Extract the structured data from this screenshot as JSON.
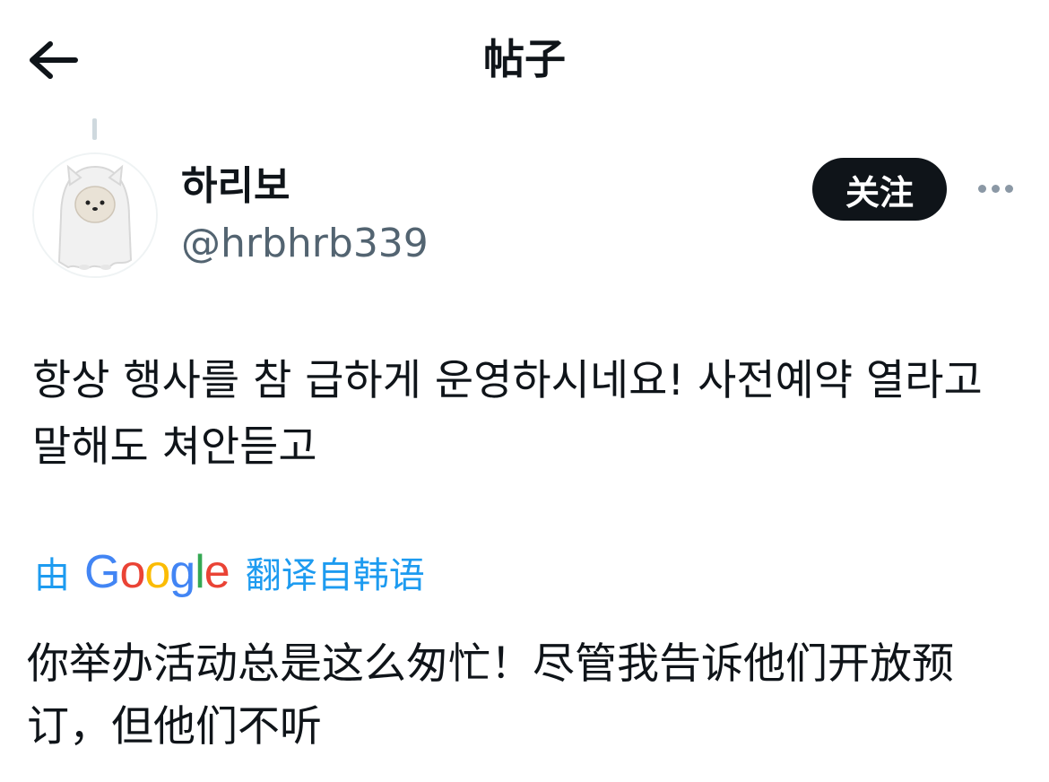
{
  "header": {
    "title": "帖子",
    "back_icon": "arrow-left-icon"
  },
  "author": {
    "display_name": "하리보",
    "handle": "@hrbhrb339",
    "avatar_icon": "ghost-dog-avatar"
  },
  "actions": {
    "follow_label": "关注",
    "more_icon": "more-horizontal-icon"
  },
  "post": {
    "text": "항상 행사를 참 급하게 운영하시네요! 사전예약 열라고 말해도 쳐안듣고"
  },
  "translation": {
    "by_label": "由",
    "provider_letters": [
      "G",
      "o",
      "o",
      "g",
      "l",
      "e"
    ],
    "from_label": "翻译自韩语",
    "text": "你举办活动总是这么匆忙！尽管我告诉他们开放预订，但他们不听"
  },
  "colors": {
    "text_primary": "#0f1419",
    "text_secondary": "#536471",
    "link_blue": "#1d9bf0",
    "follow_bg": "#0f1419",
    "google_blue": "#4285f4",
    "google_red": "#ea4335",
    "google_yellow": "#fbbc05",
    "google_green": "#34a853"
  }
}
